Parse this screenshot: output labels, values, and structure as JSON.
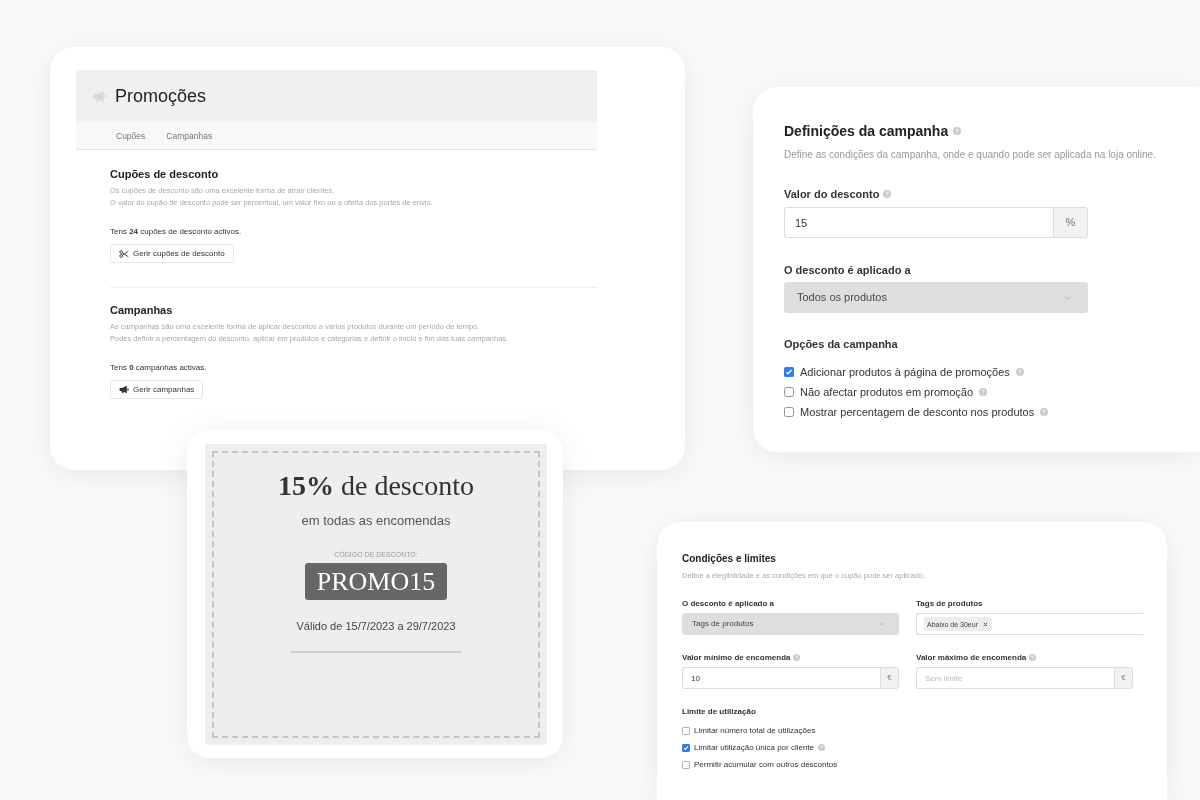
{
  "promotions_panel": {
    "title": "Promoções",
    "tabs": [
      {
        "label": "Cupões",
        "selected": false
      },
      {
        "label": "Campanhas",
        "selected": false
      }
    ],
    "sections": [
      {
        "heading": "Cupões de desconto",
        "description": [
          "Os cupões de desconto são uma excelente forma de atrair clientes.",
          "O valor do cupão de desconto pode ser percentual, um valor fixo ou a oferta dos portes de envio."
        ],
        "summary": "Tens **24** cupões de desconto activos.",
        "button": "Gerir cupões de desconto"
      },
      {
        "heading": "Campanhas",
        "description": [
          "As campanhas são uma excelente forma de aplicar descontos a vários produtos durante um período de tempo.",
          "Podes definir a percentagem do desconto, aplicar em produtos e categorias e definir o início e fim das tuas campanhas."
        ],
        "summary": "Tens **0** campanhas activas.",
        "button": "Gerir campanhas"
      }
    ]
  },
  "coupon_preview": {
    "headline": "**15%** de desconto",
    "subtitle": "em todas as encomendas",
    "code_label": "CÓDIGO DE DESCONTO:",
    "code": "PROMO15",
    "validity": "Válido de 15/7/2023 a 29/7/2023"
  },
  "campaign_settings": {
    "title": "Definições da campanha",
    "title_help": true,
    "description": "Define as condições da campanha, onde e quando pode ser aplicada na loja online.",
    "discount_value": {
      "label": "Valor do desconto",
      "help": true,
      "value": "15",
      "unit": "%"
    },
    "applies_to": {
      "label": "O desconto é aplicado a",
      "help": false,
      "value": "Todos os produtos"
    },
    "options": {
      "heading": "Opções da campanha",
      "items": [
        {
          "label": "Adicionar produtos à página de promoções",
          "checked": true,
          "help": true
        },
        {
          "label": "Não afectar produtos em promoção",
          "checked": false,
          "help": true
        },
        {
          "label": "Mostrar percentagem de desconto nos produtos",
          "checked": false,
          "help": true
        }
      ]
    }
  },
  "conditions_and_limits": {
    "title": "Condições e limites",
    "description": "Define a elegibilidade e as condições em que o cupão pode ser aplicado.",
    "fields": [
      {
        "kind": "select",
        "label": "O desconto é aplicado a",
        "help": false,
        "value": "Tags de produtos"
      },
      {
        "kind": "tags",
        "label": "Tags de produtos",
        "help": false,
        "tags": [
          "Abaixo de 30eur"
        ]
      },
      {
        "kind": "amount",
        "label": "Valor mínimo de encomenda",
        "help": true,
        "value": "10",
        "unit": "€"
      },
      {
        "kind": "amount",
        "label": "Valor máximo de encomenda",
        "help": true,
        "placeholder": "Sem limite",
        "unit": "€"
      }
    ],
    "usage_limit": {
      "heading": "Limite de utilização",
      "items": [
        {
          "label": "Limitar número total de utilizações",
          "checked": false,
          "help": false
        },
        {
          "label": "Limitar utilização única por cliente",
          "checked": true,
          "help": true
        },
        {
          "label": "Permitir acumular com outros descontos",
          "checked": false,
          "help": false
        }
      ]
    }
  }
}
